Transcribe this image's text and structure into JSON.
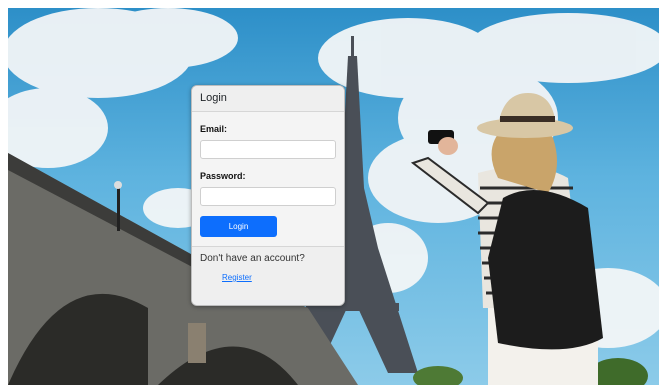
{
  "login": {
    "title": "Login",
    "email_label": "Email:",
    "email_value": "",
    "password_label": "Password:",
    "password_value": "",
    "submit_label": "Login",
    "footer_text": "Don't have an account?",
    "register_label": "Register"
  },
  "colors": {
    "primary": "#0d6efd",
    "card_bg": "#f4f4f4",
    "sky": "#5eb3df"
  }
}
